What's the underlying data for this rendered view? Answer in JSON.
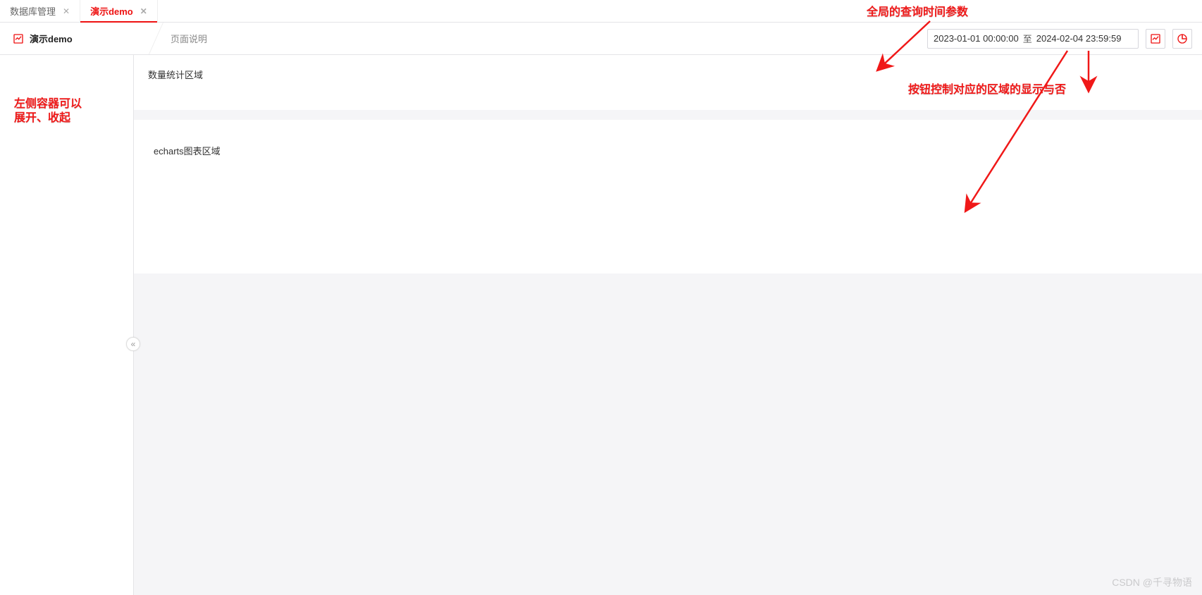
{
  "tabs": [
    {
      "label": "数据库管理",
      "active": false
    },
    {
      "label": "演示demo",
      "active": true
    }
  ],
  "header": {
    "title": "演示demo",
    "desc": "页面说明",
    "date_from": "2023-01-01 00:00:00",
    "date_to_word": "至",
    "date_to": "2024-02-04 23:59:59"
  },
  "panels": {
    "stats_label": "数量统计区域",
    "chart_label": "echarts图表区域"
  },
  "annotations": {
    "top_right": "全局的查询时间参数",
    "mid_right": "按钮控制对应的区域的显示与否",
    "left": "左侧容器可以\n展开、收起"
  },
  "watermark": "CSDN @千寻物语",
  "colors": {
    "accent": "#e11"
  }
}
